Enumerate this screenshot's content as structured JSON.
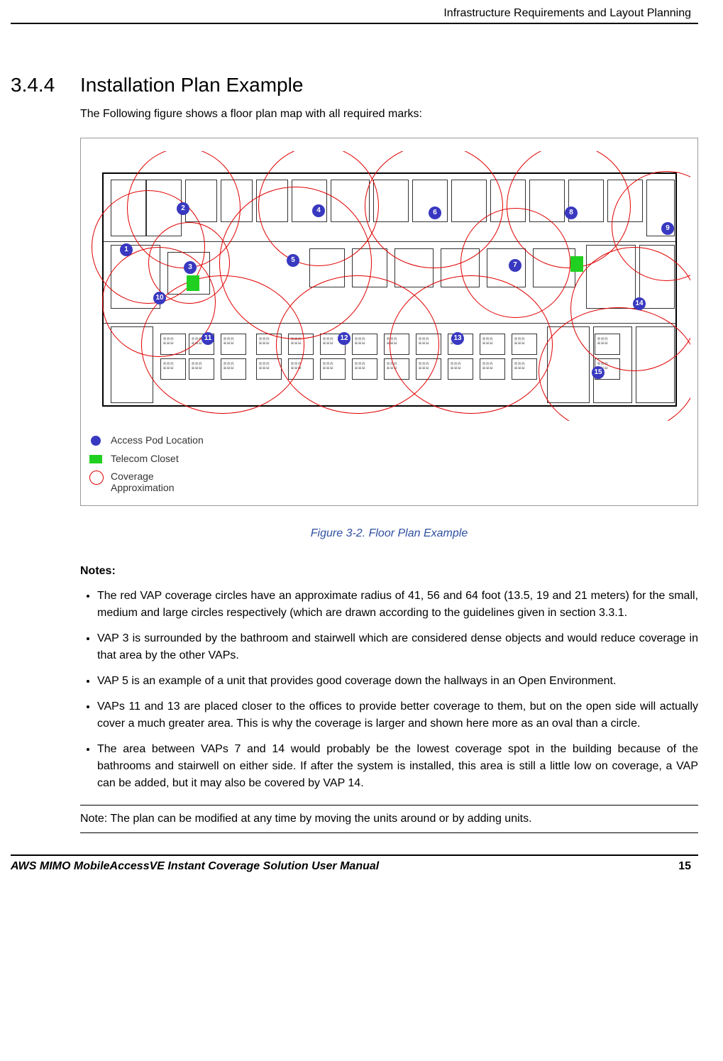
{
  "header": {
    "doc_section": "Infrastructure Requirements and Layout Planning"
  },
  "section": {
    "number": "3.4.4",
    "title": "Installation Plan Example",
    "intro": "The Following figure shows a floor plan map with all required marks:"
  },
  "figure": {
    "caption": "Figure 3-2. Floor Plan Example",
    "legend": {
      "access_pod": "Access Pod Location",
      "telecom_closet": "Telecom Closet",
      "coverage_line1": "Coverage",
      "coverage_line2": "Approximation"
    },
    "pods": [
      "1",
      "2",
      "3",
      "4",
      "5",
      "6",
      "7",
      "8",
      "9",
      "10",
      "11",
      "12",
      "13",
      "14",
      "15"
    ]
  },
  "notes": {
    "heading": "Notes:",
    "items": [
      "The red VAP coverage circles have an approximate radius of 41, 56 and 64 foot (13.5, 19 and 21 meters) for the small, medium and large circles respectively (which are drawn according to the guidelines given in section 3.3.1.",
      "VAP 3 is surrounded by the bathroom and stairwell which are considered dense objects and would reduce coverage in that area by the other VAPs.",
      "VAP 5 is an example of a unit that provides good coverage down the hallways in an Open Environment.",
      "VAPs 11 and 13 are placed closer to the offices to provide better coverage to them, but on the open side will actually cover a much greater area.  This is why the coverage is larger and shown here more as an oval than a circle.",
      "The area between VAPs 7 and 14 would probably be the lowest coverage spot in the building because of the bathrooms and stairwell on either side. If after the system is installed, this area is still a little low on coverage, a VAP can be added, but it may also be covered by VAP 14."
    ],
    "boxed": "Note: The plan can be modified at any time by moving the units around or by adding units."
  },
  "footer": {
    "doc_title": "AWS MIMO MobileAccessVE Instant Coverage Solution User Manual",
    "page_number": "15"
  }
}
